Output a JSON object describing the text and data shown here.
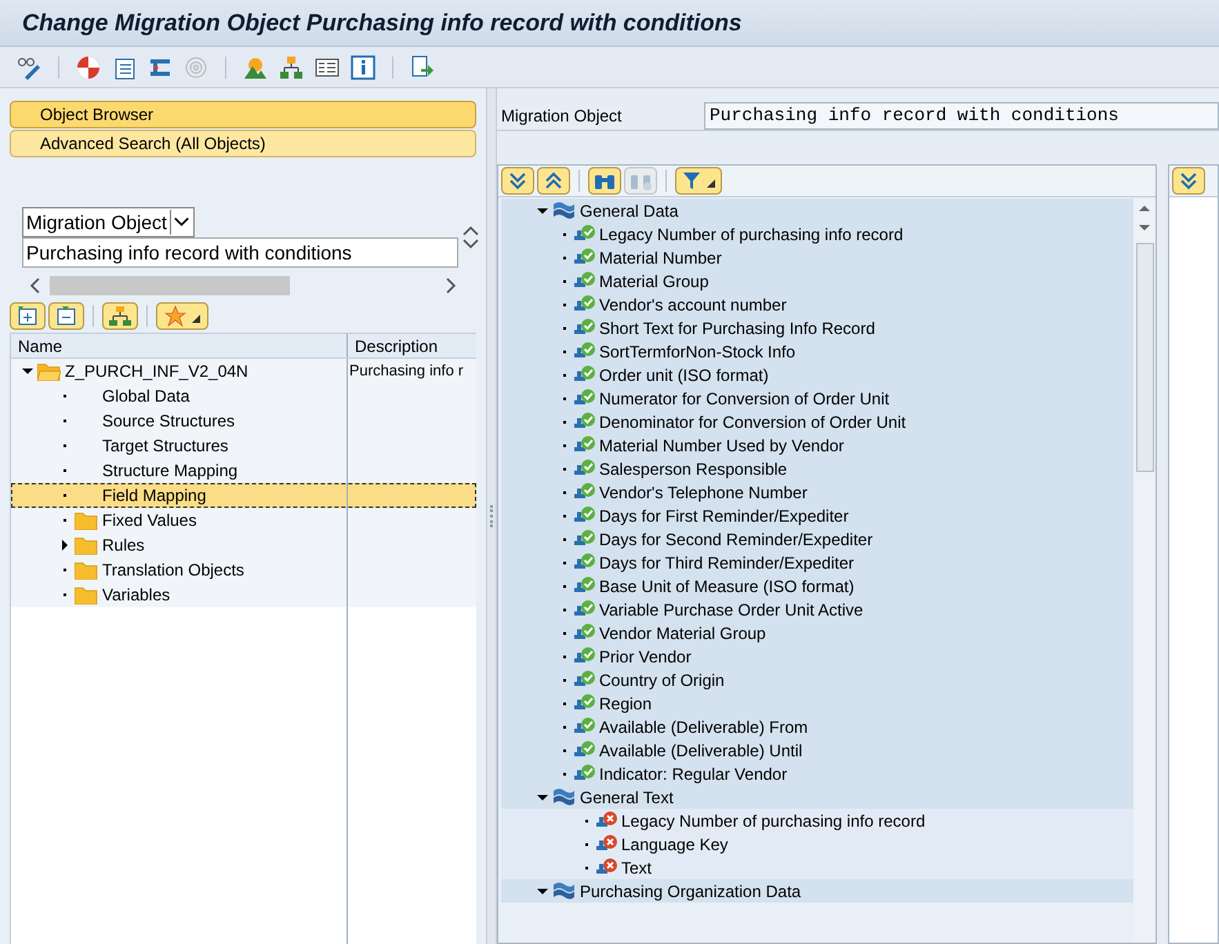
{
  "window": {
    "title": "Change Migration Object Purchasing info record with conditions"
  },
  "left": {
    "buttons": [
      {
        "label": "Object Browser",
        "selected": true
      },
      {
        "label": "Advanced Search (All Objects)",
        "selected": false
      }
    ],
    "dropdown": {
      "value": "Migration Object"
    },
    "search": {
      "value": "Purchasing info record with conditions"
    },
    "tree": {
      "columns": [
        "Name",
        "Description"
      ],
      "root": {
        "label": "Z_PURCH_INF_V2_04N",
        "description": "Purchasing info r",
        "expanded": true,
        "children": [
          {
            "label": "Global Data",
            "kind": "node",
            "selected": false
          },
          {
            "label": "Source Structures",
            "kind": "node",
            "selected": false
          },
          {
            "label": "Target Structures",
            "kind": "node",
            "selected": false
          },
          {
            "label": "Structure Mapping",
            "kind": "node",
            "selected": false
          },
          {
            "label": "Field Mapping",
            "kind": "node",
            "selected": true
          },
          {
            "label": "Fixed Values",
            "kind": "folder",
            "selected": false
          },
          {
            "label": "Rules",
            "kind": "folder",
            "selected": false,
            "expanded": false
          },
          {
            "label": "Translation Objects",
            "kind": "folder",
            "selected": false
          },
          {
            "label": "Variables",
            "kind": "folder",
            "selected": false
          }
        ]
      }
    }
  },
  "right": {
    "field": {
      "label": "Migration Object",
      "value": "Purchasing info record with conditions"
    },
    "groups": [
      {
        "label": "General Data",
        "expanded": true,
        "children": [
          {
            "label": "Legacy Number of purchasing info record",
            "mapped": true
          },
          {
            "label": "Material Number",
            "mapped": true
          },
          {
            "label": "Material Group",
            "mapped": true
          },
          {
            "label": "Vendor's account number",
            "mapped": true
          },
          {
            "label": "Short Text for Purchasing Info Record",
            "mapped": true
          },
          {
            "label": "SortTermforNon-Stock Info",
            "mapped": true
          },
          {
            "label": "Order unit (ISO format)",
            "mapped": true
          },
          {
            "label": "Numerator for Conversion of Order Unit",
            "mapped": true
          },
          {
            "label": "Denominator for Conversion of Order Unit",
            "mapped": true
          },
          {
            "label": "Material Number Used by Vendor",
            "mapped": true
          },
          {
            "label": "Salesperson Responsible",
            "mapped": true
          },
          {
            "label": "Vendor's Telephone Number",
            "mapped": true
          },
          {
            "label": "Days for First Reminder/Expediter",
            "mapped": true
          },
          {
            "label": "Days for Second Reminder/Expediter",
            "mapped": true
          },
          {
            "label": "Days for Third Reminder/Expediter",
            "mapped": true
          },
          {
            "label": "Base Unit of Measure (ISO format)",
            "mapped": true
          },
          {
            "label": "Variable Purchase Order Unit Active",
            "mapped": true
          },
          {
            "label": "Vendor Material Group",
            "mapped": true
          },
          {
            "label": "Prior Vendor",
            "mapped": true
          },
          {
            "label": "Country of Origin",
            "mapped": true
          },
          {
            "label": "Region",
            "mapped": true
          },
          {
            "label": "Available (Deliverable) From",
            "mapped": true
          },
          {
            "label": "Available (Deliverable) Until",
            "mapped": true
          },
          {
            "label": "Indicator: Regular Vendor",
            "mapped": true
          }
        ]
      },
      {
        "label": "General Text",
        "expanded": true,
        "children": [
          {
            "label": "Legacy Number of purchasing info record",
            "mapped": false
          },
          {
            "label": "Language Key",
            "mapped": false
          },
          {
            "label": "Text",
            "mapped": false
          }
        ]
      },
      {
        "label": "Purchasing Organization Data",
        "expanded": true
      }
    ]
  }
}
